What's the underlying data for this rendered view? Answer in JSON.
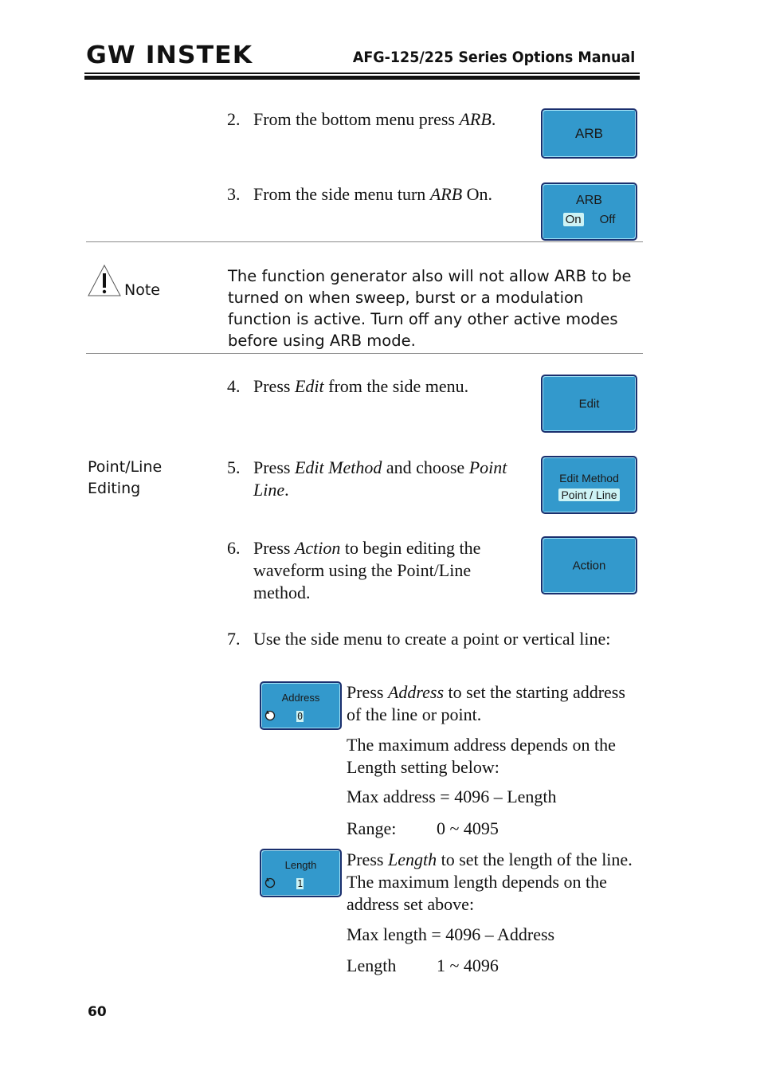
{
  "header": {
    "logo": "GW INSTEK",
    "title": "AFG-125/225 Series Options Manual"
  },
  "steps": [
    {
      "num": "2.",
      "pre": "From the bottom menu press ",
      "em": "ARB",
      "post": "."
    },
    {
      "num": "3.",
      "pre": "From the side menu turn ",
      "em": "ARB",
      "post": " On."
    },
    {
      "num": "4.",
      "pre": "Press ",
      "em": "Edit",
      "post": " from the side menu."
    },
    {
      "num": "5.",
      "pre": "Press ",
      "em": "Edit Method",
      "mid": " and choose ",
      "em2": "Point Line",
      "post": "."
    },
    {
      "num": "6.",
      "pre": "Press ",
      "em": "Action",
      "post": " to begin editing the waveform using the Point/Line method."
    },
    {
      "num": "7.",
      "text": "Use the side menu to create a point or vertical line:"
    }
  ],
  "note": {
    "label": "Note",
    "icon": "warning-triangle-icon",
    "text": "The function generator also will not allow ARB to be turned on when sweep, burst or a modulation function is active. Turn off any other active modes before using ARB mode."
  },
  "side_section": {
    "label_line1": "Point/Line",
    "label_line2": "Editing"
  },
  "softkeys": {
    "arb": "ARB",
    "arb_toggle": {
      "title": "ARB",
      "on": "On",
      "off": "Off",
      "selected": "On"
    },
    "edit": "Edit",
    "edit_method": {
      "title": "Edit Method",
      "value": "Point / Line"
    },
    "action": "Action",
    "address": {
      "title": "Address",
      "value": "0",
      "icon": "rotary-knob-icon"
    },
    "length": {
      "title": "Length",
      "value": "1",
      "icon": "rotary-knob-icon"
    }
  },
  "address_info": {
    "pre": "Press ",
    "em": "Address",
    "post": " to set the starting address of the line or point.",
    "para2": "The maximum address depends on the Length setting below:",
    "formula": "Max address = 4096 – Length",
    "range_label": "Range:",
    "range_value": "0 ~ 4095"
  },
  "length_info": {
    "pre": "Press ",
    "em": "Length",
    "post": " to set the length of the line. The maximum length depends on the address set above:",
    "formula": "Max length = 4096 – Address",
    "range_label": "Length",
    "range_value": "1 ~ 4096"
  },
  "footer": {
    "page_number": "60"
  }
}
